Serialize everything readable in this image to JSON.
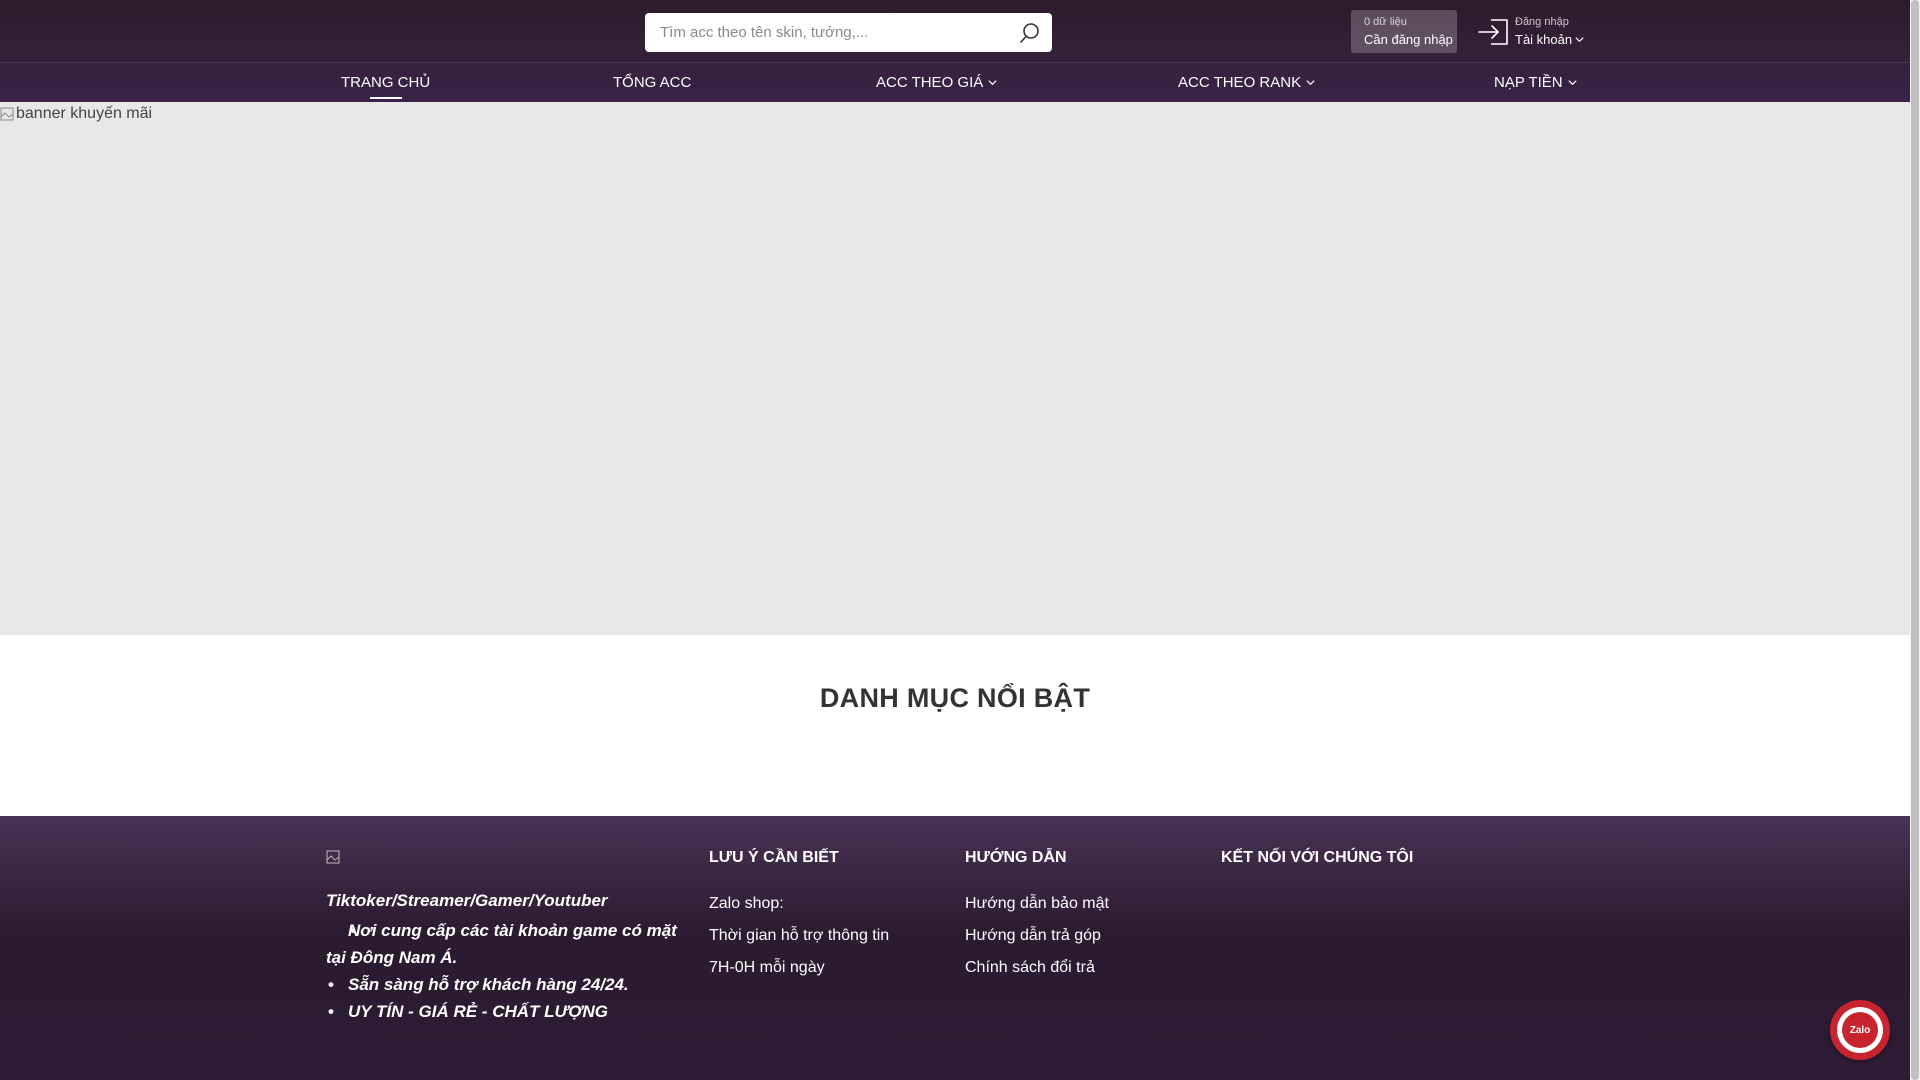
{
  "search": {
    "placeholder": "Tìm acc theo tên skin, tướng,..."
  },
  "cart": {
    "count_text": "0 dữ liệu",
    "status_text": "Cần đăng nhập"
  },
  "account": {
    "login_text": "Đăng nhập",
    "account_text": "Tài khoản"
  },
  "nav": {
    "items": [
      {
        "label": "TRANG CHỦ",
        "active": true
      },
      {
        "label": "TỔNG ACC"
      },
      {
        "label": "ACC THEO GIÁ",
        "dropdown": true
      },
      {
        "label": "ACC THEO RANK",
        "dropdown": true
      },
      {
        "label": "NẠP TIỀN",
        "dropdown": true
      }
    ]
  },
  "banner": {
    "alt_text": "banner khuyến mãi"
  },
  "section": {
    "title": "DANH MỤC NỔI BẬT"
  },
  "footer": {
    "tagline": "Tiktoker/Streamer/Gamer/Youtuber",
    "bullets": [
      "Nơi cung cấp các tài khoản game có mặt tại Đông Nam Á.",
      "Sẵn sàng hỗ trợ khách hàng 24/24.",
      "UY TÍN - GIÁ RẺ - CHẤT LƯỢNG"
    ],
    "col1": {
      "title": "LƯU Ý CẦN BIẾT",
      "items": [
        "Zalo shop:",
        "Thời gian hỗ trợ thông tin",
        "7H-0H mỗi ngày"
      ]
    },
    "col2": {
      "title": "HƯỚNG DẪN",
      "items": [
        "Hướng dẫn bảo mật",
        "Hướng dẫn trả góp",
        "Chính sách đổi trả"
      ]
    },
    "col3": {
      "title": "KẾT NỐI VỚI CHÚNG TÔI"
    }
  },
  "zalo": {
    "label": "Zalo"
  },
  "colors": {
    "header_bg": "#35203a",
    "banner_bg": "#e9e8e9",
    "zalo_red": "#c8242f"
  }
}
